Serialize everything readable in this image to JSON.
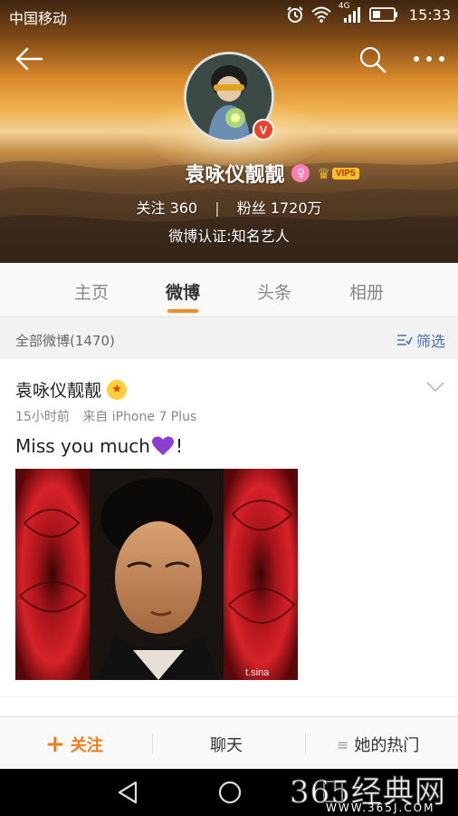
{
  "status_bar": {
    "carrier": "中国移动",
    "network": "4G",
    "time": "15:33"
  },
  "header": {
    "icons": [
      "back-arrow-icon",
      "search-icon",
      "more-dots-icon"
    ],
    "profile": {
      "name": "袁咏仪靓靓",
      "vip_label": "VIP5",
      "following_label": "关注",
      "following_count": "360",
      "followers_label": "粉丝",
      "followers_count": "1720万",
      "verification": "微博认证:知名艺人"
    }
  },
  "tabs": [
    {
      "label": "主页",
      "active": false
    },
    {
      "label": "微博",
      "active": true
    },
    {
      "label": "头条",
      "active": false
    },
    {
      "label": "相册",
      "active": false
    }
  ],
  "filter": {
    "all_posts": "全部微博(1470)",
    "filter_label": "筛选"
  },
  "post": {
    "author": "袁咏仪靓靓",
    "time": "15小时前",
    "source": "来自 iPhone 7 Plus",
    "text": "Miss you much",
    "text_suffix": "!",
    "emoji": "purple-heart-icon",
    "image_watermark": "t.sina"
  },
  "action_bar": {
    "follow_label": "关注",
    "chat_label": "聊天",
    "hot_label": "她的热门"
  },
  "watermark": {
    "brand": "365经典网",
    "url": "WWW.365J.COM"
  },
  "colors": {
    "accent_orange": "#f28a26",
    "link_blue": "#4a6fb5",
    "verified_red": "#e8442b"
  }
}
